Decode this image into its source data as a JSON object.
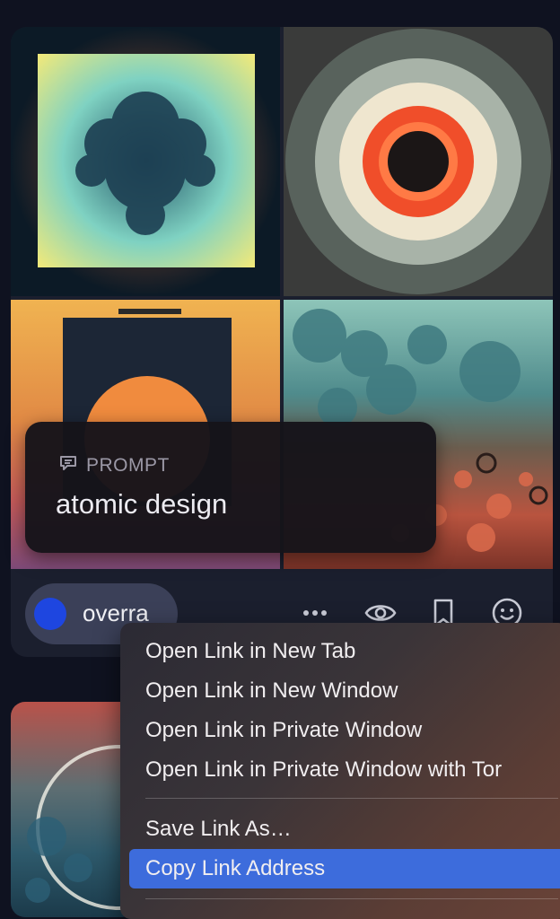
{
  "prompt": {
    "label": "PROMPT",
    "text": "atomic design"
  },
  "user": {
    "name": "overra"
  },
  "actions": [
    "more-icon",
    "eye-icon",
    "bookmark-icon",
    "smile-icon"
  ],
  "context_menu": {
    "items": [
      "Open Link in New Tab",
      "Open Link in New Window",
      "Open Link in Private Window",
      "Open Link in Private Window with Tor",
      "Save Link As…",
      "Copy Link Address"
    ],
    "highlighted": "Copy Link Address"
  },
  "colors": {
    "accent": "#3d6cdc",
    "avatar": "#1e46e0",
    "background": "#0f1220"
  }
}
